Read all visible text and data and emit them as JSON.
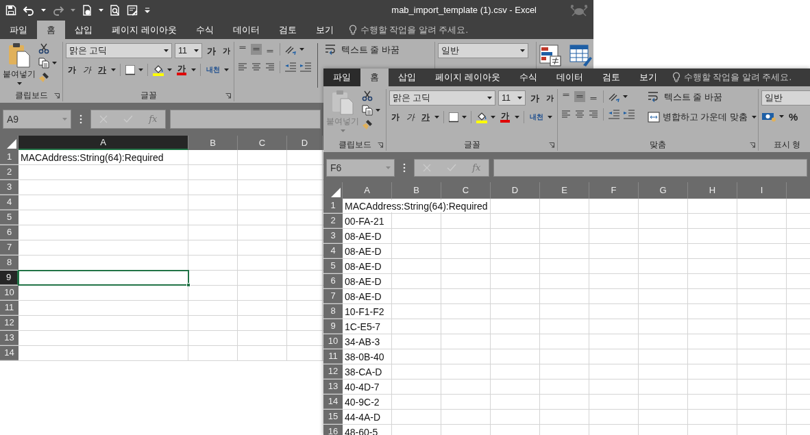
{
  "windows": [
    {
      "title": "mab_import_template (1).csv - Excel",
      "tabs": [
        {
          "label": "파일",
          "selected": false
        },
        {
          "label": "홈",
          "selected": true
        },
        {
          "label": "삽입",
          "selected": false
        },
        {
          "label": "페이지 레이아웃",
          "selected": false
        },
        {
          "label": "수식",
          "selected": false
        },
        {
          "label": "데이터",
          "selected": false
        },
        {
          "label": "검토",
          "selected": false
        },
        {
          "label": "보기",
          "selected": false
        }
      ],
      "tell_me": "수행할 작업을 알려 주세요.",
      "ribbon": {
        "groups": [
          {
            "kind": "clipboard",
            "label": "클립보드",
            "paste_label": "붙여넣기",
            "paste_enabled": true
          },
          {
            "kind": "font",
            "label": "글꼴",
            "font_name": "맑은 고딕",
            "font_size": "11",
            "grow": "가",
            "shrink": "가",
            "bold": "가",
            "italic": "가",
            "underline": "가",
            "font_color": "가",
            "phonetic": "내천"
          },
          {
            "kind": "alignment",
            "vertical_align": [
              {
                "selected": false
              },
              {
                "selected": true
              },
              {
                "selected": false
              }
            ],
            "wrap_text": "텍스트 줄 바꿈"
          },
          {
            "kind": "number",
            "format": "일반"
          },
          {
            "kind": "styles"
          }
        ]
      },
      "name_box": "A9",
      "fx": "fx",
      "columns": [
        {
          "label": "A",
          "selected": true
        },
        {
          "label": "B",
          "selected": false
        },
        {
          "label": "C",
          "selected": false
        },
        {
          "label": "D",
          "selected": false
        }
      ],
      "rows": [
        {
          "number": "1",
          "selected": false,
          "cells": [
            "MACAddress:String(64):Required"
          ]
        },
        {
          "number": "2",
          "selected": false
        },
        {
          "number": "3",
          "selected": false
        },
        {
          "number": "4",
          "selected": false
        },
        {
          "number": "5",
          "selected": false
        },
        {
          "number": "6",
          "selected": false
        },
        {
          "number": "7",
          "selected": false
        },
        {
          "number": "8",
          "selected": false
        },
        {
          "number": "9",
          "selected": true
        },
        {
          "number": "10",
          "selected": false
        },
        {
          "number": "11",
          "selected": false
        },
        {
          "number": "12",
          "selected": false
        },
        {
          "number": "13",
          "selected": false
        },
        {
          "number": "14",
          "selected": false
        }
      ]
    },
    {
      "tabs": [
        {
          "label": "파일",
          "selected": false
        },
        {
          "label": "홈",
          "selected": true
        },
        {
          "label": "삽입",
          "selected": false
        },
        {
          "label": "페이지 레이아웃",
          "selected": false
        },
        {
          "label": "수식",
          "selected": false
        },
        {
          "label": "데이터",
          "selected": false
        },
        {
          "label": "검토",
          "selected": false
        },
        {
          "label": "보기",
          "selected": false
        }
      ],
      "tell_me": "수행할 작업을 알려 주세요.",
      "ribbon": {
        "groups": [
          {
            "kind": "clipboard",
            "label": "클립보드",
            "paste_label": "붙여넣기",
            "paste_enabled": false
          },
          {
            "kind": "font",
            "label": "글꼴",
            "font_name": "맑은 고딕",
            "font_size": "11",
            "grow": "가",
            "shrink": "가",
            "bold": "가",
            "italic": "가",
            "underline": "가",
            "font_color": "가",
            "phonetic": "내천"
          },
          {
            "kind": "alignment",
            "label": "맞춤",
            "vertical_align": [
              {
                "selected": false
              },
              {
                "selected": true
              },
              {
                "selected": false
              }
            ],
            "wrap_text": "텍스트 줄 바꿈",
            "merge": "병합하고 가운데 맞춤"
          },
          {
            "kind": "number",
            "label": "표시 형",
            "format": "일반",
            "percent": "%"
          }
        ]
      },
      "name_box": "F6",
      "fx": "fx",
      "columns": [
        {
          "label": "A",
          "selected": false
        },
        {
          "label": "B",
          "selected": false
        },
        {
          "label": "C",
          "selected": false
        },
        {
          "label": "D",
          "selected": false
        },
        {
          "label": "E",
          "selected": false
        },
        {
          "label": "F",
          "selected": false
        },
        {
          "label": "G",
          "selected": false
        },
        {
          "label": "H",
          "selected": false
        },
        {
          "label": "I",
          "selected": false
        }
      ],
      "rows": [
        {
          "number": "1",
          "selected": false,
          "cells": [
            "MACAddress:String(64):Required"
          ]
        },
        {
          "number": "2",
          "selected": false,
          "cells": [
            "00-FA-21"
          ]
        },
        {
          "number": "3",
          "selected": false,
          "cells": [
            "08-AE-D"
          ]
        },
        {
          "number": "4",
          "selected": false,
          "cells": [
            "08-AE-D"
          ]
        },
        {
          "number": "5",
          "selected": false,
          "cells": [
            "08-AE-D"
          ]
        },
        {
          "number": "6",
          "selected": false,
          "cells": [
            "08-AE-D"
          ]
        },
        {
          "number": "7",
          "selected": false,
          "cells": [
            "08-AE-D"
          ]
        },
        {
          "number": "8",
          "selected": false,
          "cells": [
            "10-F1-F2"
          ]
        },
        {
          "number": "9",
          "selected": false,
          "cells": [
            "1C-E5-7"
          ]
        },
        {
          "number": "10",
          "selected": false,
          "cells": [
            "34-AB-3"
          ]
        },
        {
          "number": "11",
          "selected": false,
          "cells": [
            "38-0B-40"
          ]
        },
        {
          "number": "12",
          "selected": false,
          "cells": [
            "38-CA-D"
          ]
        },
        {
          "number": "13",
          "selected": false,
          "cells": [
            "40-4D-7"
          ]
        },
        {
          "number": "14",
          "selected": false,
          "cells": [
            "40-9C-2"
          ]
        },
        {
          "number": "15",
          "selected": false,
          "cells": [
            "44-4A-D"
          ]
        },
        {
          "number": "16",
          "selected": false,
          "cells": [
            "48-60-5"
          ]
        }
      ]
    }
  ]
}
